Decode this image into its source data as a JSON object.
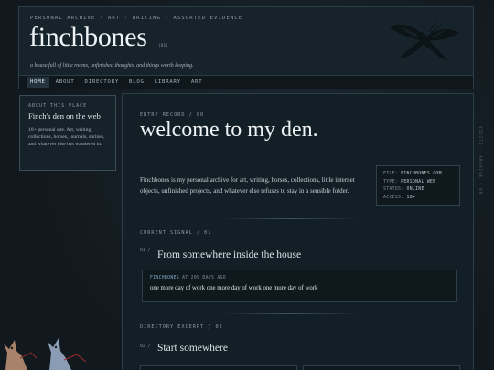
{
  "header": {
    "kicker": "PERSONAL ARCHIVE · ART · WRITING · ASSORTED EVIDENCE",
    "title": "finchbones",
    "version": "(01)",
    "tagline": "a house full of little rooms, unfinished thoughts, and things worth keeping."
  },
  "nav": {
    "items": [
      "HOME",
      "ABOUT",
      "DIRECTORY",
      "BLOG",
      "LIBRARY",
      "ART"
    ],
    "active": "HOME"
  },
  "sidebar": {
    "label": "ABOUT THIS PLACE",
    "title": "Finch's den on the web",
    "description": "18+ personal site. Art, writing, collections, horses, journals, shrines, and whatever else has wandered in."
  },
  "main": {
    "entry_label": "ENTRY RECORD / 00",
    "headline": "welcome to my den.",
    "intro": "Finchbones is my personal archive for art, writing, horses, collections, little internet objects, unfinished projects, and whatever else refuses to stay in a sensible folder.",
    "info": {
      "file_k": "FILE:",
      "file_v": "FINCHBONES.COM",
      "type_k": "TYPE:",
      "type_v": "PERSONAL WEB",
      "status_k": "STATUS:",
      "status_v": "ONLINE",
      "access_k": "ACCESS:",
      "access_v": "18+"
    },
    "signal": {
      "label": "CURRENT SIGNAL / 01",
      "num": "01 /",
      "title": "From somewhere inside the house",
      "card_user": "FINCHBONES",
      "card_meta": "AT 209 DAYS AGO",
      "card_text": "one more day of work one more day of work one more day of work"
    },
    "directory": {
      "label": "DIRECTORY EXCERPT / 02",
      "num": "02 /",
      "title": "Start somewhere"
    },
    "vertical_text": "VISITS · ARCHIVE · 00"
  },
  "colors": {
    "background": "#141c22",
    "panel": "#16232b",
    "border": "#2c3d47",
    "link": "#7fa6c5",
    "title": "#eef3f5"
  }
}
